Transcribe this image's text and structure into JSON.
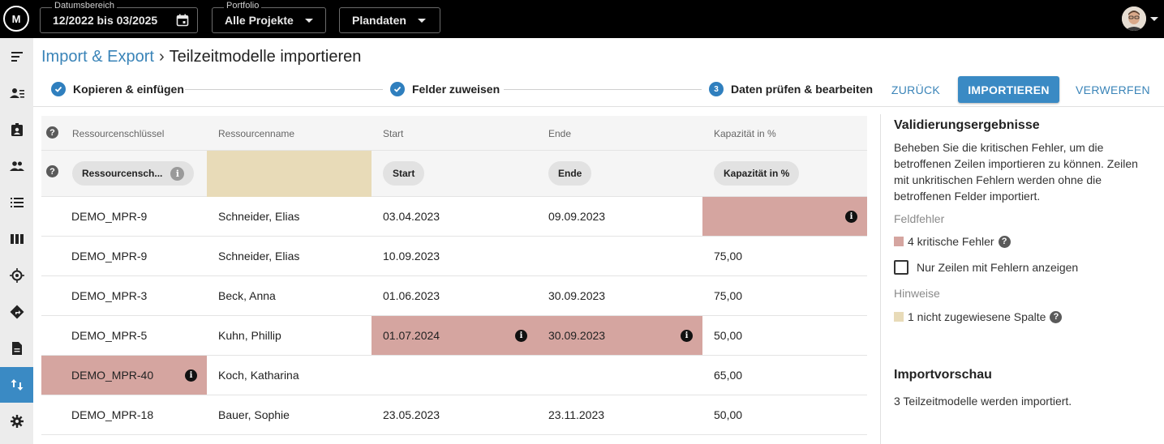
{
  "topbar": {
    "logo": "M",
    "date_range": {
      "label": "Datumsbereich",
      "value": "12/2022 bis 03/2025"
    },
    "portfolio": {
      "label": "Portfolio",
      "value": "Alle Projekte"
    },
    "data_type": {
      "value": "Plandaten"
    }
  },
  "breadcrumb": {
    "parent": "Import & Export",
    "separator": "›",
    "current": "Teilzeitmodelle importieren"
  },
  "stepper": {
    "steps": [
      {
        "label": "Kopieren & einfügen",
        "state": "done"
      },
      {
        "label": "Felder zuweisen",
        "state": "done"
      },
      {
        "label": "Daten prüfen & bearbeiten",
        "number": "3",
        "state": "active"
      }
    ]
  },
  "actions": {
    "back": "ZURÜCK",
    "import": "IMPORTIEREN",
    "discard": "VERWERFEN"
  },
  "table": {
    "columns": [
      "Ressourcenschlüssel",
      "Ressourcenname",
      "Start",
      "Ende",
      "Kapazität in %"
    ],
    "mapping": [
      "Ressourcensch...",
      "",
      "Start",
      "Ende",
      "Kapazität in %"
    ],
    "rows": [
      {
        "key": "DEMO_MPR-9",
        "name": "Schneider, Elias",
        "start": "03.04.2023",
        "end": "09.09.2023",
        "capacity": ""
      },
      {
        "key": "DEMO_MPR-9",
        "name": "Schneider, Elias",
        "start": "10.09.2023",
        "end": "",
        "capacity": "75,00"
      },
      {
        "key": "DEMO_MPR-3",
        "name": "Beck, Anna",
        "start": "01.06.2023",
        "end": "30.09.2023",
        "capacity": "75,00"
      },
      {
        "key": "DEMO_MPR-5",
        "name": "Kuhn, Phillip",
        "start": "01.07.2024",
        "end": "30.09.2023",
        "capacity": "50,00"
      },
      {
        "key": "DEMO_MPR-40",
        "name": "Koch, Katharina",
        "start": "",
        "end": "",
        "capacity": "65,00"
      },
      {
        "key": "DEMO_MPR-18",
        "name": "Bauer, Sophie",
        "start": "23.05.2023",
        "end": "23.11.2023",
        "capacity": "50,00"
      }
    ]
  },
  "validation": {
    "title": "Validierungsergebnisse",
    "description": "Beheben Sie die kritischen Fehler, um die betroffenen Zeilen importieren zu können. Zeilen mit unkritischen Fehlern werden ohne die betroffenen Felder importiert.",
    "field_errors_label": "Feldfehler",
    "critical_errors": "4 kritische Fehler",
    "only_error_rows": "Nur Zeilen mit Fehlern anzeigen",
    "hints_label": "Hinweise",
    "unassigned_column": "1 nicht zugewiesene Spalte"
  },
  "preview": {
    "title": "Importvorschau",
    "text": "3 Teilzeitmodelle werden importiert."
  },
  "colors": {
    "accent": "#3a8ac4",
    "error": "#d5a5a0",
    "unassigned": "#e8dbb8"
  }
}
